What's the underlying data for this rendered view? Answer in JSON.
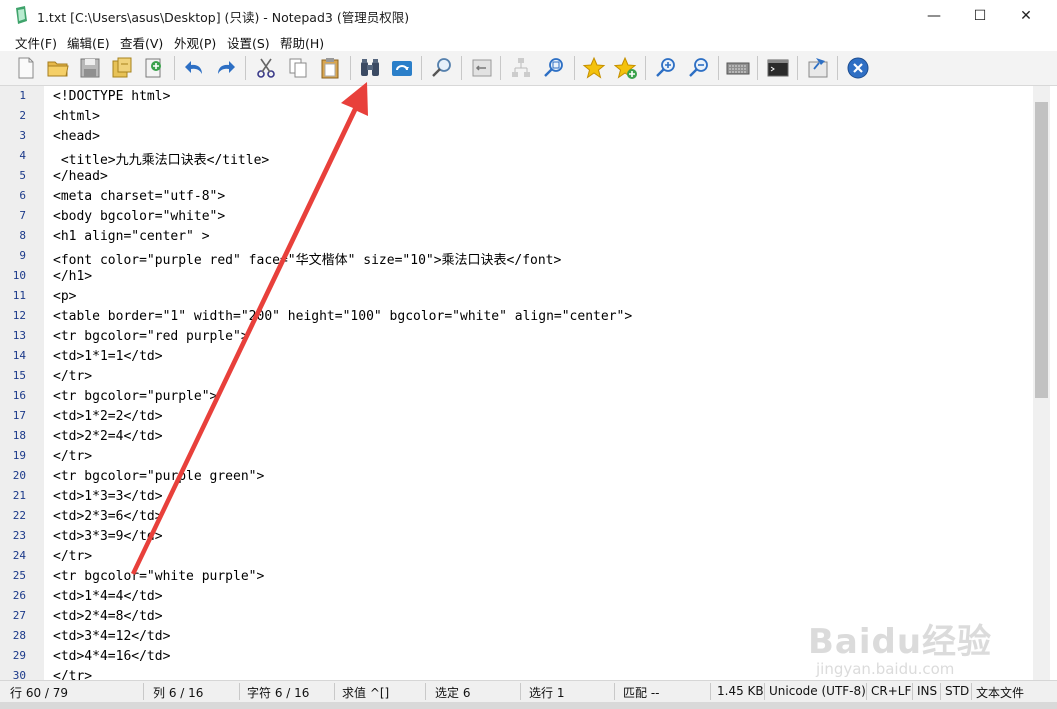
{
  "window": {
    "title": "1.txt [C:\\Users\\asus\\Desktop]  (只读)  - Notepad3  (管理员权限)",
    "minimize": "—",
    "maximize": "☐",
    "close": "✕"
  },
  "menu": [
    "文件(F)",
    "编辑(E)",
    "查看(V)",
    "外观(P)",
    "设置(S)",
    "帮助(H)"
  ],
  "toolbar": [
    {
      "name": "new-file-icon"
    },
    {
      "name": "open-folder-icon"
    },
    {
      "name": "save-icon"
    },
    {
      "name": "save-as-icon"
    },
    {
      "name": "save-copy-icon"
    },
    {
      "name": "undo-icon"
    },
    {
      "name": "redo-icon"
    },
    {
      "name": "cut-icon"
    },
    {
      "name": "copy-icon"
    },
    {
      "name": "paste-icon"
    },
    {
      "name": "find-binoculars-icon"
    },
    {
      "name": "replace-icon"
    },
    {
      "name": "find-magnifier-icon"
    },
    {
      "name": "word-wrap-icon"
    },
    {
      "name": "fold-tree-icon"
    },
    {
      "name": "zoom-fit-icon"
    },
    {
      "name": "favorite-star-icon"
    },
    {
      "name": "add-favorite-icon"
    },
    {
      "name": "zoom-in-icon"
    },
    {
      "name": "zoom-out-icon"
    },
    {
      "name": "keyboard-icon"
    },
    {
      "name": "terminal-icon"
    },
    {
      "name": "pin-icon"
    },
    {
      "name": "exit-icon"
    }
  ],
  "lines": [
    "<!DOCTYPE html>",
    "<html>",
    "<head>",
    " <title>九九乘法口诀表</title>",
    "</head>",
    "<meta charset=\"utf-8\">",
    "<body bgcolor=\"white\">",
    "<h1 align=\"center\" >",
    "<font color=\"purple red\" face=\"华文楷体\" size=\"10\">乘法口诀表</font>",
    "</h1>",
    "<p>",
    "<table border=\"1\" width=\"200\" height=\"100\" bgcolor=\"white\" align=\"center\">",
    "<tr bgcolor=\"red purple\">",
    "<td>1*1=1</td>",
    "</tr>",
    "<tr bgcolor=\"purple\">",
    "<td>1*2=2</td>",
    "<td>2*2=4</td>",
    "</tr>",
    "<tr bgcolor=\"purple green\">",
    "<td>1*3=3</td>",
    "<td>2*3=6</td>",
    "<td>3*3=9</td>",
    "</tr>",
    "<tr bgcolor=\"white purple\">",
    "<td>1*4=4</td>",
    "<td>2*4=8</td>",
    "<td>3*4=12</td>",
    "<td>4*4=16</td>",
    "</tr>"
  ],
  "status": {
    "line": "行 60 / 79",
    "col": "列  6 / 16",
    "char": "字符  6 / 16",
    "value": "求值  ^[]",
    "selection": "选定  6",
    "selected_lines": "选行  1",
    "match": "匹配  --",
    "size": "1.45 KB",
    "encoding": "Unicode (UTF-8)",
    "eol": "CR+LF",
    "ins": "INS",
    "std": "STD",
    "filetype": "文本文件"
  },
  "watermark": {
    "logo": "Baidu经验",
    "sub": "jingyan.baidu.com"
  },
  "colors": {
    "accent_arrow": "#e8403b",
    "line_numbers": "#1c3a8a",
    "gutter": "#eeeeee"
  }
}
